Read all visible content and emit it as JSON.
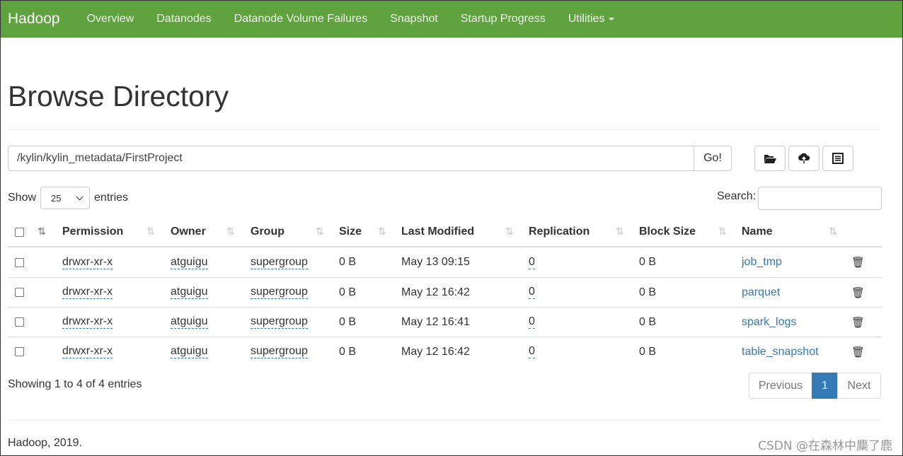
{
  "navbar": {
    "brand": "Hadoop",
    "items": [
      "Overview",
      "Datanodes",
      "Datanode Volume Failures",
      "Snapshot",
      "Startup Progress",
      "Utilities"
    ],
    "bg_color": "#5fa33e"
  },
  "page_title": "Browse Directory",
  "path_bar": {
    "path": "/kylin/kylin_metadata/FirstProject",
    "go_label": "Go!",
    "icons": [
      "folder-open-icon",
      "cloud-upload-icon",
      "list-alt-icon"
    ]
  },
  "length": {
    "show_label": "Show",
    "value": "25",
    "entries_label": "entries"
  },
  "search": {
    "label": "Search:",
    "value": ""
  },
  "table": {
    "headers": [
      "Permission",
      "Owner",
      "Group",
      "Size",
      "Last Modified",
      "Replication",
      "Block Size",
      "Name"
    ],
    "rows": [
      {
        "permission": "drwxr-xr-x",
        "owner": "atguigu",
        "group": "supergroup",
        "size": "0 B",
        "modified": "May 13 09:15",
        "replication": "0",
        "block_size": "0 B",
        "name": "job_tmp"
      },
      {
        "permission": "drwxr-xr-x",
        "owner": "atguigu",
        "group": "supergroup",
        "size": "0 B",
        "modified": "May 12 16:42",
        "replication": "0",
        "block_size": "0 B",
        "name": "parquet"
      },
      {
        "permission": "drwxr-xr-x",
        "owner": "atguigu",
        "group": "supergroup",
        "size": "0 B",
        "modified": "May 12 16:41",
        "replication": "0",
        "block_size": "0 B",
        "name": "spark_logs"
      },
      {
        "permission": "drwxr-xr-x",
        "owner": "atguigu",
        "group": "supergroup",
        "size": "0 B",
        "modified": "May 12 16:42",
        "replication": "0",
        "block_size": "0 B",
        "name": "table_snapshot"
      }
    ]
  },
  "info": "Showing 1 to 4 of 4 entries",
  "pagination": {
    "previous": "Previous",
    "current": "1",
    "next": "Next",
    "active_color": "#337ab7"
  },
  "footer": "Hadoop, 2019.",
  "watermark": "CSDN @在森林中麋了鹿"
}
